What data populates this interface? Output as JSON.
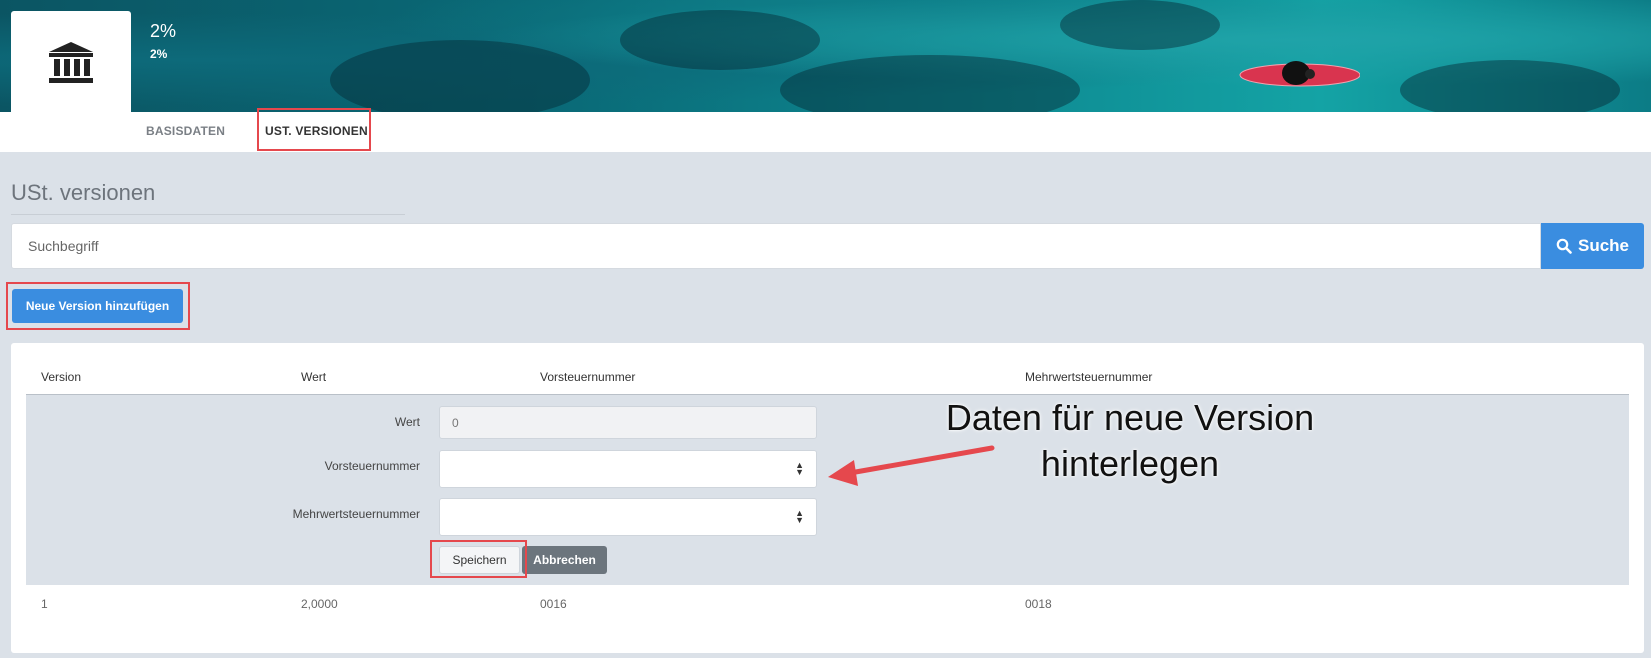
{
  "header": {
    "title": "2%",
    "subtitle": "2%",
    "logo_icon": "bank-icon"
  },
  "tabs": [
    {
      "label": "BASISDATEN",
      "active": false
    },
    {
      "label": "UST. VERSIONEN",
      "active": true
    }
  ],
  "section_title": "USt. versionen",
  "search": {
    "placeholder": "Suchbegriff",
    "value": "",
    "button_label": "Suche",
    "button_icon": "search-icon"
  },
  "new_version_button": "Neue Version hinzufügen",
  "table": {
    "columns": [
      "Version",
      "Wert",
      "Vorsteuernummer",
      "Mehrwertsteuernummer"
    ],
    "rows": [
      {
        "version": "1",
        "wert": "2,0000",
        "vorsteuernummer": "0016",
        "mehrwertsteuernummer": "0018"
      }
    ]
  },
  "edit_form": {
    "wert_label": "Wert",
    "wert_value": "0",
    "vorsteuernummer_label": "Vorsteuernummer",
    "vorsteuernummer_value": "",
    "mehrwertsteuernummer_label": "Mehrwertsteuernummer",
    "mehrwertsteuernummer_value": "",
    "save_label": "Speichern",
    "cancel_label": "Abbrechen"
  },
  "annotation": {
    "line1": "Daten für neue Version",
    "line2": "hinterlegen"
  },
  "colors": {
    "primary": "#3a8de0",
    "highlight": "#e5484d",
    "page_bg": "#dbe1e8",
    "cancel": "#6c757d"
  }
}
